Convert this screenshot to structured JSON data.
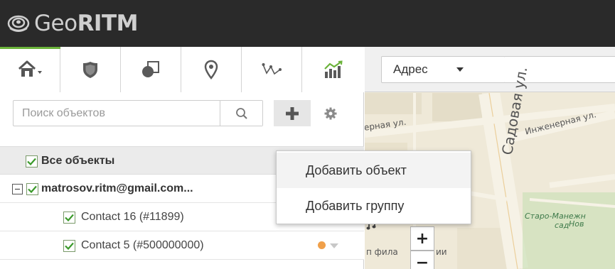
{
  "app": {
    "logo_prefix": "Geo",
    "logo_bold": "RITM"
  },
  "toolbar": {
    "buttons": [
      {
        "name": "home",
        "icon": "home-icon",
        "has_caret": true
      },
      {
        "name": "shield",
        "icon": "shield-icon"
      },
      {
        "name": "zones",
        "icon": "zones-icon"
      },
      {
        "name": "places",
        "icon": "map-pin-icon"
      },
      {
        "name": "routes",
        "icon": "route-icon"
      },
      {
        "name": "reports",
        "icon": "chart-icon"
      }
    ],
    "accent_color": "#6bb33a"
  },
  "search": {
    "placeholder": "Поиск объектов",
    "value": ""
  },
  "tree": {
    "all_objects_label": "Все объекты",
    "all_objects_checked": true,
    "group": {
      "label": "matrosov.ritm@gmail.com...",
      "checked": true,
      "expanded": true
    },
    "items": [
      {
        "label": "Contact 16 (#11899)",
        "checked": true,
        "status_color": "#6cc53a"
      },
      {
        "label": "Contact 5 (#500000000)",
        "checked": true,
        "status_color": "#f0a04a"
      }
    ]
  },
  "add_menu": {
    "items": [
      {
        "label": "Добавить объект",
        "hovered": true
      },
      {
        "label": "Добавить группу",
        "hovered": false
      }
    ]
  },
  "map": {
    "address_select": {
      "selected": "Адрес"
    },
    "address_input": {
      "value": ""
    },
    "streets": [
      {
        "text": "Садовая ул."
      },
      {
        "text": "Инженерная ул."
      },
      {
        "text": "ерная ул."
      },
      {
        "text": "Старо-Манежн"
      },
      {
        "text": "сад"
      },
      {
        "text": "Нов"
      },
      {
        "text": "п фила"
      },
      {
        "text": "ии"
      }
    ],
    "zoom_in_label": "+",
    "zoom_out_label": "−"
  }
}
